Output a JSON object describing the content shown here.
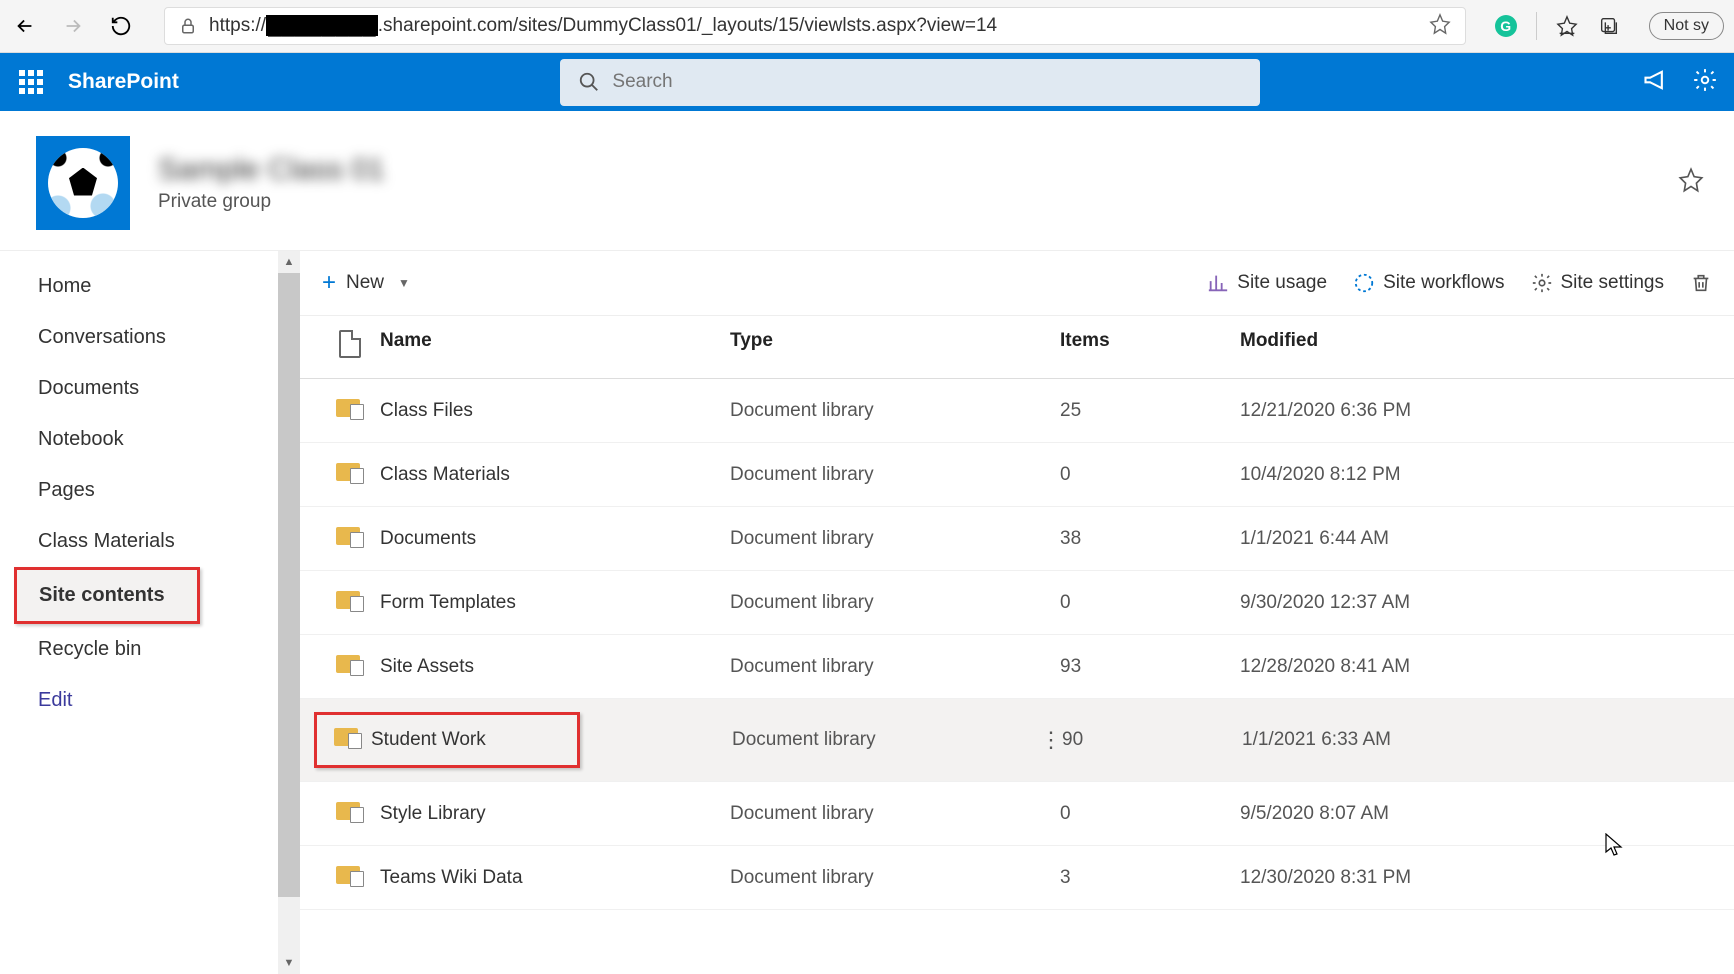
{
  "browser": {
    "url_prefix": "https://",
    "url_redacted": "████████",
    "url_suffix": ".sharepoint.com/sites/DummyClass01/_layouts/15/viewlsts.aspx?view=14",
    "not_syncing": "Not sy"
  },
  "header": {
    "product": "SharePoint",
    "search_placeholder": "Search"
  },
  "site": {
    "name": "Sample Class 01",
    "subtitle": "Private group"
  },
  "nav": {
    "items": [
      {
        "label": "Home"
      },
      {
        "label": "Conversations"
      },
      {
        "label": "Documents"
      },
      {
        "label": "Notebook"
      },
      {
        "label": "Pages"
      },
      {
        "label": "Class Materials"
      },
      {
        "label": "Site contents"
      },
      {
        "label": "Recycle bin"
      }
    ],
    "edit": "Edit"
  },
  "toolbar": {
    "new_label": "New",
    "site_usage": "Site usage",
    "site_workflows": "Site workflows",
    "site_settings": "Site settings"
  },
  "columns": {
    "name": "Name",
    "type": "Type",
    "items": "Items",
    "modified": "Modified"
  },
  "rows": [
    {
      "name": "Class Files",
      "type": "Document library",
      "items": "25",
      "modified": "12/21/2020 6:36 PM"
    },
    {
      "name": "Class Materials",
      "type": "Document library",
      "items": "0",
      "modified": "10/4/2020 8:12 PM"
    },
    {
      "name": "Documents",
      "type": "Document library",
      "items": "38",
      "modified": "1/1/2021 6:44 AM"
    },
    {
      "name": "Form Templates",
      "type": "Document library",
      "items": "0",
      "modified": "9/30/2020 12:37 AM"
    },
    {
      "name": "Site Assets",
      "type": "Document library",
      "items": "93",
      "modified": "12/28/2020 8:41 AM"
    },
    {
      "name": "Student Work",
      "type": "Document library",
      "items": "90",
      "modified": "1/1/2021 6:33 AM"
    },
    {
      "name": "Style Library",
      "type": "Document library",
      "items": "0",
      "modified": "9/5/2020 8:07 AM"
    },
    {
      "name": "Teams Wiki Data",
      "type": "Document library",
      "items": "3",
      "modified": "12/30/2020 8:31 PM"
    }
  ]
}
